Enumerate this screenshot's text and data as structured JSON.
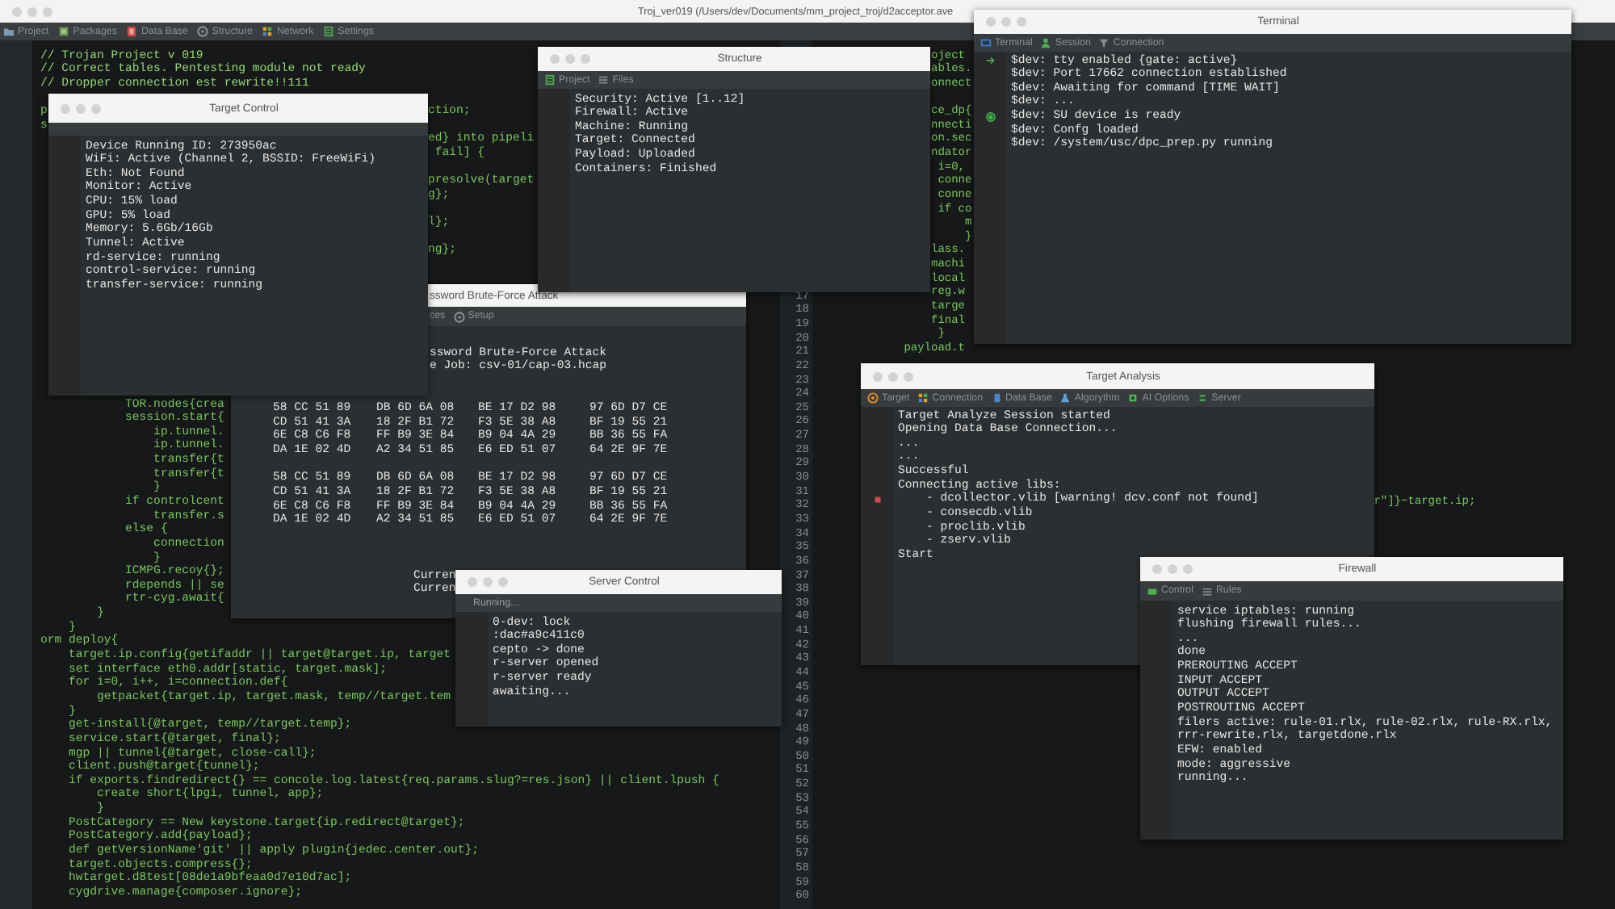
{
  "main_window": {
    "title": "Troj_ver019 (/Users/dev/Documents/mm_project_troj/d2acceptor.ave",
    "tabs": [
      {
        "label": "Project"
      },
      {
        "label": "Packages"
      },
      {
        "label": "Data Base"
      },
      {
        "label": "Structure"
      },
      {
        "label": "Network"
      },
      {
        "label": "Settings"
      }
    ]
  },
  "editor": {
    "left_lines": [
      {
        "kind": "comment",
        "text": "// Trojan Project v 019"
      },
      {
        "kind": "comment",
        "text": "// Correct tables. Pentesting module not ready"
      },
      {
        "kind": "comment",
        "text": "// Dropper connection est rewrite!!111"
      },
      {
        "kind": "blank"
      },
      {
        "kind": "code",
        "text": "p",
        "tail": "ction;"
      },
      {
        "kind": "code",
        "text": "s"
      },
      {
        "kind": "code",
        "tail": "ed} into pipeli"
      },
      {
        "kind": "code",
        "tail": " fail] {"
      },
      {
        "kind": "blank"
      },
      {
        "kind": "code",
        "tail": "presolve(target"
      },
      {
        "kind": "code",
        "tail": "g};"
      },
      {
        "kind": "blank"
      },
      {
        "kind": "code",
        "tail": "l};"
      },
      {
        "kind": "blank"
      },
      {
        "kind": "code",
        "tail": "ng};"
      },
      {
        "kind": "blank"
      },
      {
        "kind": "blank"
      },
      {
        "kind": "blank"
      },
      {
        "kind": "blank"
      },
      {
        "kind": "blank"
      },
      {
        "kind": "blank"
      },
      {
        "kind": "blank"
      },
      {
        "kind": "blank"
      },
      {
        "kind": "blank"
      },
      {
        "kind": "blank"
      },
      {
        "kind": "code",
        "text": "            TOR.nodes{crea"
      },
      {
        "kind": "code",
        "text": "            session.start{"
      },
      {
        "kind": "code",
        "text": "                ip.tunnel."
      },
      {
        "kind": "code",
        "text": "                ip.tunnel."
      },
      {
        "kind": "code",
        "text": "                transfer{t"
      },
      {
        "kind": "code",
        "text": "                transfer{t"
      },
      {
        "kind": "code",
        "text": "                }"
      },
      {
        "kind": "code",
        "text": "            if controlcent"
      },
      {
        "kind": "code",
        "text": "                transfer.s"
      },
      {
        "kind": "code",
        "text": "            else {"
      },
      {
        "kind": "code",
        "text": "                connection"
      },
      {
        "kind": "code",
        "text": "                }"
      },
      {
        "kind": "code",
        "text": "            ICMPG.recoy{};"
      },
      {
        "kind": "code",
        "text": "            rdepends || se"
      },
      {
        "kind": "code",
        "text": "            rtr-cyg.await{"
      },
      {
        "kind": "code",
        "text": "        }"
      },
      {
        "kind": "code",
        "text": "    }"
      },
      {
        "kind": "code",
        "text": "orm deploy{"
      },
      {
        "kind": "code",
        "text": "    target.ip.config{getifaddr || target@target.ip, target"
      },
      {
        "kind": "code",
        "text": "    set interface eth0.addr[static, target.mask];"
      },
      {
        "kind": "code",
        "text": "    for i=0, i++, i=connection.def{"
      },
      {
        "kind": "code",
        "text": "        getpacket{target.ip, target.mask, temp//target.tem"
      },
      {
        "kind": "code",
        "text": "    }"
      },
      {
        "kind": "code",
        "text": "    get-install{@target, temp//target.temp};"
      },
      {
        "kind": "code",
        "text": "    service.start{@target, final};"
      },
      {
        "kind": "code",
        "text": "    mgp || tunnel{@target, close-call};"
      },
      {
        "kind": "code",
        "text": "    client.push@target{tunnel};"
      },
      {
        "kind": "code",
        "text": "    if exports.findredirect{} == concole.log.latest{req.params.slug?=res.json} || client.lpush {"
      },
      {
        "kind": "code",
        "text": "        create short{lpgi, tunnel, app};"
      },
      {
        "kind": "code",
        "text": "        }"
      },
      {
        "kind": "code",
        "text": "    PostCategory == New keystone.target{ip.redirect@target};"
      },
      {
        "kind": "code",
        "text": "    PostCategory.add{payload};"
      },
      {
        "kind": "code",
        "text": "    def getVersionName'git' || apply plugin{jedec.center.out};"
      },
      {
        "kind": "code",
        "text": "    target.objects.compress{};"
      },
      {
        "kind": "code",
        "text": "    hwtarget.d8test[08de1a9bfeaa0d7e10d7ac];"
      },
      {
        "kind": "code",
        "text": "    cygdrive.manage{composer.ignore};"
      }
    ],
    "line_numbers": [
      "17",
      "18",
      "19",
      "20",
      "21",
      "22",
      "23",
      "24",
      "25",
      "26",
      "27",
      "28",
      "29",
      "30",
      "31",
      "32",
      "33",
      "34",
      "35",
      "36",
      "37",
      "38",
      "39",
      "40",
      "41",
      "42",
      "43",
      "44",
      "45",
      "46",
      "47",
      "48",
      "49",
      "50",
      "51",
      "52",
      "53",
      "54",
      "55",
      "56",
      "57",
      "58",
      "59",
      "60"
    ],
    "right_lines": [
      {
        "kind": "code",
        "text": "    oject"
      },
      {
        "kind": "code",
        "text": "    ables."
      },
      {
        "kind": "code",
        "text": "    onnect"
      },
      {
        "kind": "blank"
      },
      {
        "kind": "code",
        "text": "    ce_dp{"
      },
      {
        "kind": "code",
        "text": "    nnecti"
      },
      {
        "kind": "code",
        "text": "    on.sec"
      },
      {
        "kind": "code",
        "text": "    ndator"
      },
      {
        "kind": "code",
        "text": "     i=0,"
      },
      {
        "kind": "code",
        "text": "     conne"
      },
      {
        "kind": "code",
        "text": "     conne"
      },
      {
        "kind": "code",
        "text": "     if co"
      },
      {
        "kind": "code",
        "text": "         m"
      },
      {
        "kind": "code",
        "text": "         }"
      },
      {
        "kind": "code",
        "text": "    lass."
      },
      {
        "kind": "code",
        "text": "    machi"
      },
      {
        "kind": "code",
        "text": "    local"
      },
      {
        "kind": "code",
        "text": "    reg.w"
      },
      {
        "kind": "code",
        "text": "    targe"
      },
      {
        "kind": "code",
        "text": "    final"
      },
      {
        "kind": "code",
        "text": "     }"
      },
      {
        "kind": "code",
        "text": "payload.t"
      },
      {
        "kind": "blank"
      },
      {
        "kind": "blank"
      },
      {
        "kind": "blank"
      },
      {
        "kind": "blank"
      },
      {
        "kind": "blank"
      },
      {
        "kind": "blank"
      },
      {
        "kind": "blank"
      },
      {
        "kind": "blank"
      },
      {
        "kind": "blank"
      },
      {
        "kind": "blank"
      },
      {
        "kind": "code",
        "tail": "r\"]}~target.ip;"
      }
    ]
  },
  "windows": [
    {
      "kind": "target_control",
      "title": "Target Control",
      "lines": [
        {
          "kind": "text",
          "text": "Device Running ID: 273950ac"
        },
        {
          "kind": "text",
          "text": "WiFi: Active (Channel 2, BSSID: FreeWiFi)"
        },
        {
          "kind": "text",
          "text": "Eth: Not Found"
        },
        {
          "kind": "text",
          "text": "Monitor: Active"
        },
        {
          "kind": "text",
          "text": "CPU: 15% load"
        },
        {
          "kind": "text",
          "text": "GPU: 5% load"
        },
        {
          "kind": "text",
          "text": "Memory: 5.6Gb/16Gb"
        },
        {
          "kind": "text",
          "text": "Tunnel: Active"
        },
        {
          "kind": "text",
          "text": "rd-service: running"
        },
        {
          "kind": "text",
          "text": "control-service: running"
        },
        {
          "kind": "text",
          "text": "transfer-service: running"
        }
      ]
    },
    {
      "kind": "structure",
      "title": "Structure",
      "tabs": [
        {
          "label": "Project"
        },
        {
          "label": "Files"
        }
      ],
      "lines": [
        {
          "kind": "text",
          "text": "Security: Active [1..12]"
        },
        {
          "kind": "text",
          "text": "Firewall: Active"
        },
        {
          "kind": "text",
          "text": "Machine: Running"
        },
        {
          "kind": "text",
          "text": "Target: Connected"
        },
        {
          "kind": "text",
          "text": "Payload: Uploaded"
        },
        {
          "kind": "text",
          "text": "Containers: Finished"
        }
      ]
    },
    {
      "kind": "terminal",
      "title": "Terminal",
      "tabs": [
        {
          "label": "Terminal"
        },
        {
          "label": "Session"
        },
        {
          "label": "Connection"
        }
      ],
      "lines": [
        {
          "kind": "prompt",
          "text": "$dev: tty enabled {gate: active}"
        },
        {
          "kind": "text",
          "text": "$dev: Port 17662 connection established"
        },
        {
          "kind": "text",
          "text": "$dev: Awaiting for command [TIME WAIT]"
        },
        {
          "kind": "text",
          "text": "$dev: ..."
        },
        {
          "kind": "ready",
          "text": "$dev: SU device is ready"
        },
        {
          "kind": "text",
          "text": "$dev: Confg loaded"
        },
        {
          "kind": "text",
          "text": "$dev: /system/usc/dpc_prep.py running"
        }
      ]
    },
    {
      "kind": "brute_force",
      "title": "ssword Brute-Force Attack",
      "tabs": [
        {
          "label": "ces"
        },
        {
          "label": "Setup"
        }
      ],
      "lines": [
        {
          "kind": "text",
          "text": "ssword Brute-Force Attack"
        },
        {
          "kind": "text",
          "text": "e Job: csv-01/cap-03.hcap"
        },
        {
          "kind": "blank"
        },
        {
          "kind": "blank"
        },
        {
          "kind": "hex",
          "cells": [
            "58 CC 51 89",
            "DB 6D 6A 08",
            "BE 17 D2 98",
            "97 6D D7 CE"
          ]
        },
        {
          "kind": "hex",
          "cells": [
            "CD 51 41 3A",
            "18 2F B1 72",
            "F3 5E 38 A8",
            "BF 19 55 21"
          ]
        },
        {
          "kind": "hex",
          "cells": [
            "6E C8 C6 F8",
            "FF B9 3E 84",
            "B9 04 4A 29",
            "BB 36 55 FA"
          ]
        },
        {
          "kind": "hex",
          "cells": [
            "DA 1E 02 4D",
            "A2 34 51 85",
            "E6 ED 51 07",
            "64 2E 9F 7E"
          ]
        },
        {
          "kind": "blank"
        },
        {
          "kind": "hex",
          "cells": [
            "58 CC 51 89",
            "DB 6D 6A 08",
            "BE 17 D2 98",
            "97 6D D7 CE"
          ]
        },
        {
          "kind": "hex",
          "cells": [
            "CD 51 41 3A",
            "18 2F B1 72",
            "F3 5E 38 A8",
            "BF 19 55 21"
          ]
        },
        {
          "kind": "hex",
          "cells": [
            "6E C8 C6 F8",
            "FF B9 3E 84",
            "B9 04 4A 29",
            "BB 36 55 FA"
          ]
        },
        {
          "kind": "hex",
          "cells": [
            "DA 1E 02 4D",
            "A2 34 51 85",
            "E6 ED 51 07",
            "64 2E 9F 7E"
          ]
        },
        {
          "kind": "blank"
        },
        {
          "kind": "blank"
        },
        {
          "kind": "blank"
        },
        {
          "kind": "status",
          "text": "Curren"
        },
        {
          "kind": "status",
          "text": "Curren"
        }
      ]
    },
    {
      "kind": "target_analysis",
      "title": "Target Analysis",
      "tabs": [
        {
          "label": "Target"
        },
        {
          "label": "Connection"
        },
        {
          "label": "Data Base"
        },
        {
          "label": "Algorythm"
        },
        {
          "label": "AI Options"
        },
        {
          "label": "Server"
        }
      ],
      "lines": [
        {
          "kind": "text",
          "text": "Target Analyze Session started"
        },
        {
          "kind": "text",
          "text": "Opening Data Base Connection..."
        },
        {
          "kind": "text",
          "text": "..."
        },
        {
          "kind": "text",
          "text": "..."
        },
        {
          "kind": "text",
          "text": "Successful"
        },
        {
          "kind": "text",
          "text": "Connecting active libs:"
        },
        {
          "kind": "warning",
          "text": "    - dcollector.vlib [warning! dcv.conf not found]"
        },
        {
          "kind": "text",
          "text": "    - consecdb.vlib"
        },
        {
          "kind": "text",
          "text": "    - proclib.vlib"
        },
        {
          "kind": "text",
          "text": "    - zserv.vlib"
        },
        {
          "kind": "text",
          "text": "Start"
        }
      ]
    },
    {
      "kind": "server_control",
      "title": "Server Control",
      "status": "Running...",
      "lines": [
        {
          "kind": "text",
          "text": "0-dev: lock"
        },
        {
          "kind": "text",
          "text": ":dac#a9c411c0"
        },
        {
          "kind": "text",
          "text": "cepto -> done"
        },
        {
          "kind": "text",
          "text": "r-server opened"
        },
        {
          "kind": "text",
          "text": "r-server ready"
        },
        {
          "kind": "text",
          "text": "awaiting..."
        }
      ]
    },
    {
      "kind": "firewall",
      "title": "Firewall",
      "tabs": [
        {
          "label": "Control"
        },
        {
          "label": "Rules"
        }
      ],
      "lines": [
        {
          "kind": "text",
          "text": "service iptables: running"
        },
        {
          "kind": "text",
          "text": "flushing firewall rules..."
        },
        {
          "kind": "text",
          "text": "..."
        },
        {
          "kind": "text",
          "text": "done"
        },
        {
          "kind": "text",
          "text": "PREROUTING ACCEPT"
        },
        {
          "kind": "text",
          "text": "INPUT ACCEPT"
        },
        {
          "kind": "text",
          "text": "OUTPUT ACCEPT"
        },
        {
          "kind": "text",
          "text": "POSTROUTING ACCEPT"
        },
        {
          "kind": "text",
          "text": "filers active: rule-01.rlx, rule-02.rlx, rule-RX.rlx,"
        },
        {
          "kind": "text",
          "text": "rrr-rewrite.rlx, targetdone.rlx"
        },
        {
          "kind": "text",
          "text": "EFW: enabled"
        },
        {
          "kind": "text",
          "text": "mode: aggressive"
        },
        {
          "kind": "text",
          "text": "running..."
        }
      ]
    }
  ]
}
